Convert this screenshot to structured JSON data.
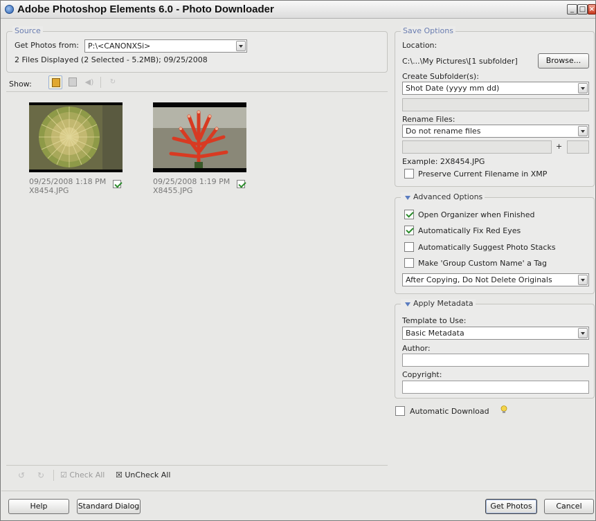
{
  "window": {
    "title": "Adobe Photoshop Elements 6.0 - Photo Downloader"
  },
  "source": {
    "legend": "Source",
    "get_from_label": "Get Photos from:",
    "get_from_value": "P:\\<CANONXSi>",
    "status": "2 Files Displayed (2 Selected - 5.2MB); 09/25/2008"
  },
  "toolbar": {
    "show_label": "Show:"
  },
  "photos": [
    {
      "datetime": "09/25/2008 1:18 PM",
      "filename": "X8454.JPG",
      "checked": true
    },
    {
      "datetime": "09/25/2008 1:19 PM",
      "filename": "X8455.JPG",
      "checked": true
    }
  ],
  "bottom_tools": {
    "check_all": "Check All",
    "uncheck_all": "UnCheck All"
  },
  "save_options": {
    "legend": "Save Options",
    "location_label": "Location:",
    "location_value": "C:\\...\\My Pictures\\[1 subfolder]",
    "browse": "Browse...",
    "subfolder_label": "Create Subfolder(s):",
    "subfolder_value": "Shot Date (yyyy mm dd)",
    "rename_label": "Rename Files:",
    "rename_value": "Do not rename files",
    "plus": "+",
    "example": "Example:  2X8454.JPG",
    "preserve": "Preserve Current Filename in XMP"
  },
  "advanced": {
    "legend": "Advanced Options",
    "open_organizer": "Open Organizer when Finished",
    "fix_red_eyes": "Automatically Fix Red Eyes",
    "suggest_stacks": "Automatically Suggest Photo Stacks",
    "group_tag": "Make 'Group Custom Name' a Tag",
    "after_copy": "After Copying, Do Not Delete Originals"
  },
  "metadata": {
    "legend": "Apply Metadata",
    "template_label": "Template to Use:",
    "template_value": "Basic Metadata",
    "author_label": "Author:",
    "copyright_label": "Copyright:"
  },
  "auto_download": "Automatic Download",
  "footer": {
    "help": "Help",
    "standard_dialog": "Standard Dialog",
    "get_photos": "Get Photos",
    "cancel": "Cancel"
  }
}
